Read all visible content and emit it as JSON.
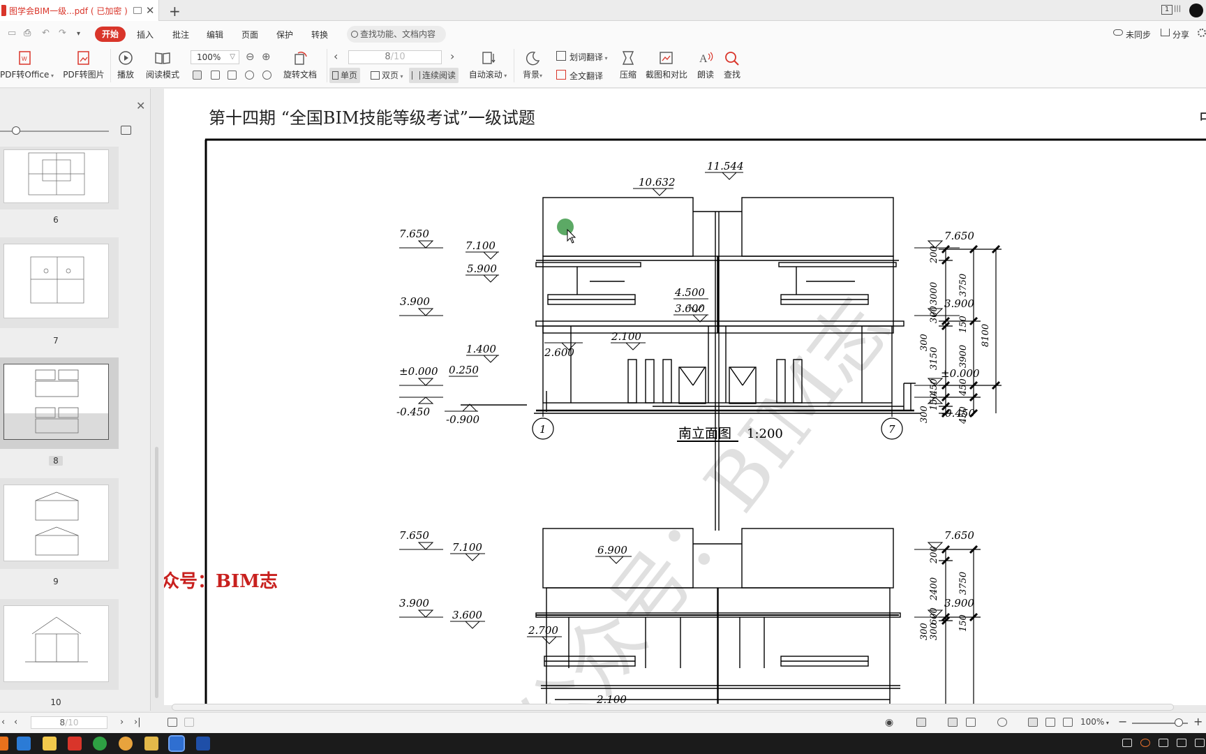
{
  "window": {
    "doc_tab_title": "图学会BIM一级...pdf ( 已加密 )",
    "new_tab": "+",
    "window_count": "1"
  },
  "menu": {
    "items": [
      "开始",
      "插入",
      "批注",
      "编辑",
      "页面",
      "保护",
      "转换"
    ],
    "search_placeholder": "查找功能、文档内容",
    "sync_label": "未同步",
    "share_label": "分享"
  },
  "ribbon": {
    "pdf_to_office": "PDF转Office",
    "pdf_to_image": "PDF转图片",
    "play": "播放",
    "read_mode": "阅读模式",
    "zoom": "100%",
    "rotate_doc": "旋转文档",
    "page_current": "8",
    "page_total": "/10",
    "single_page": "单页",
    "double_page": "双页",
    "continuous": "连续阅读",
    "auto_scroll": "自动滚动",
    "background": "背景",
    "word_translate": "划词翻译",
    "full_translate": "全文翻译",
    "compress": "压缩",
    "screenshot_compare": "截图和对比",
    "read_aloud": "朗读",
    "find": "查找"
  },
  "sidebar": {
    "thumbnails": [
      {
        "page": "6"
      },
      {
        "page": "7"
      },
      {
        "page": "8",
        "selected": true
      },
      {
        "page": "9"
      },
      {
        "page": "10"
      }
    ]
  },
  "document": {
    "header": "第十四期 “全国BIM技能等级考试”一级试题",
    "header_cut": "中",
    "watermark_text": "公众号：BIM志",
    "diagonal_watermark": "公众号：BIM志",
    "elevation1": {
      "title": "南立面图",
      "scale": "1:200",
      "left_axis": "1",
      "right_axis": "7",
      "levels_left": [
        "7.650",
        "3.900",
        "±0.000",
        "-0.450"
      ],
      "levels_right": [
        "7.650",
        "3.900",
        "±0.000",
        "-0.450"
      ],
      "inner_levels": [
        "11.544",
        "10.632",
        "7.100",
        "5.900",
        "4.500",
        "3.600",
        "2.100",
        "2.600",
        "1.400",
        "0.250",
        "-0.900"
      ],
      "dims_col1": [
        "200",
        "3000",
        "300",
        "300",
        "3150",
        "450",
        "150",
        "300"
      ],
      "dims_col2": [
        "3750",
        "150",
        "3900",
        "450",
        "450"
      ],
      "dims_col3": [
        "8100"
      ]
    },
    "elevation2": {
      "levels_left": [
        "7.650",
        "3.900"
      ],
      "levels_right": [
        "7.650",
        "3.900"
      ],
      "inner_levels": [
        "7.100",
        "6.900",
        "3.600",
        "2.700",
        "2.100"
      ],
      "dims_col1": [
        "200",
        "2400",
        "600",
        "300",
        "300"
      ],
      "dims_col2": [
        "3750",
        "150"
      ]
    }
  },
  "status": {
    "page_current": "8",
    "page_total": "/10",
    "zoom": "100%"
  },
  "colors": {
    "accent": "#d9352a",
    "watermark_red": "#c8201e",
    "cursor_dot": "#3f9a4a"
  }
}
